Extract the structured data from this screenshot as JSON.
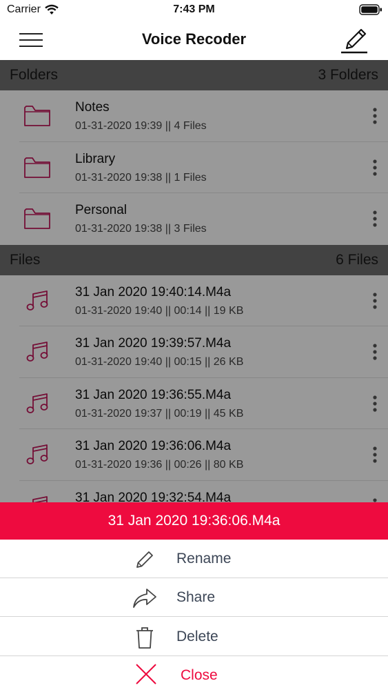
{
  "status_bar": {
    "carrier": "Carrier",
    "time": "7:43 PM"
  },
  "nav": {
    "title": "Voice Recoder",
    "left_icon": "menu-icon",
    "right_icon": "edit-pencil-icon"
  },
  "folders_section": {
    "label": "Folders",
    "count": "3 Folders"
  },
  "folders": [
    {
      "name": "Notes",
      "meta": "01-31-2020 19:39 || 4 Files"
    },
    {
      "name": "Library",
      "meta": "01-31-2020 19:38 || 1 Files"
    },
    {
      "name": "Personal",
      "meta": "01-31-2020 19:38 || 3 Files"
    }
  ],
  "files_section": {
    "label": "Files",
    "count": "6 Files"
  },
  "files": [
    {
      "name": "31 Jan 2020 19:40:14.M4a",
      "meta": "01-31-2020 19:40 || 00:14 || 19 KB"
    },
    {
      "name": "31 Jan 2020 19:39:57.M4a",
      "meta": "01-31-2020 19:40 || 00:15 || 26 KB"
    },
    {
      "name": "31 Jan 2020 19:36:55.M4a",
      "meta": "01-31-2020 19:37 || 00:19 || 45 KB"
    },
    {
      "name": "31 Jan 2020 19:36:06.M4a",
      "meta": "01-31-2020 19:36 || 00:26 || 80 KB"
    },
    {
      "name": "31 Jan 2020 19:32:54.M4a",
      "meta": ""
    }
  ],
  "action_sheet": {
    "title": "31 Jan 2020 19:36:06.M4a",
    "rename": "Rename",
    "share": "Share",
    "delete": "Delete",
    "close": "Close"
  },
  "colors": {
    "accent": "#ee0b3f",
    "icon_accent": "#c2185b",
    "section_header": "#6e6e6e"
  }
}
